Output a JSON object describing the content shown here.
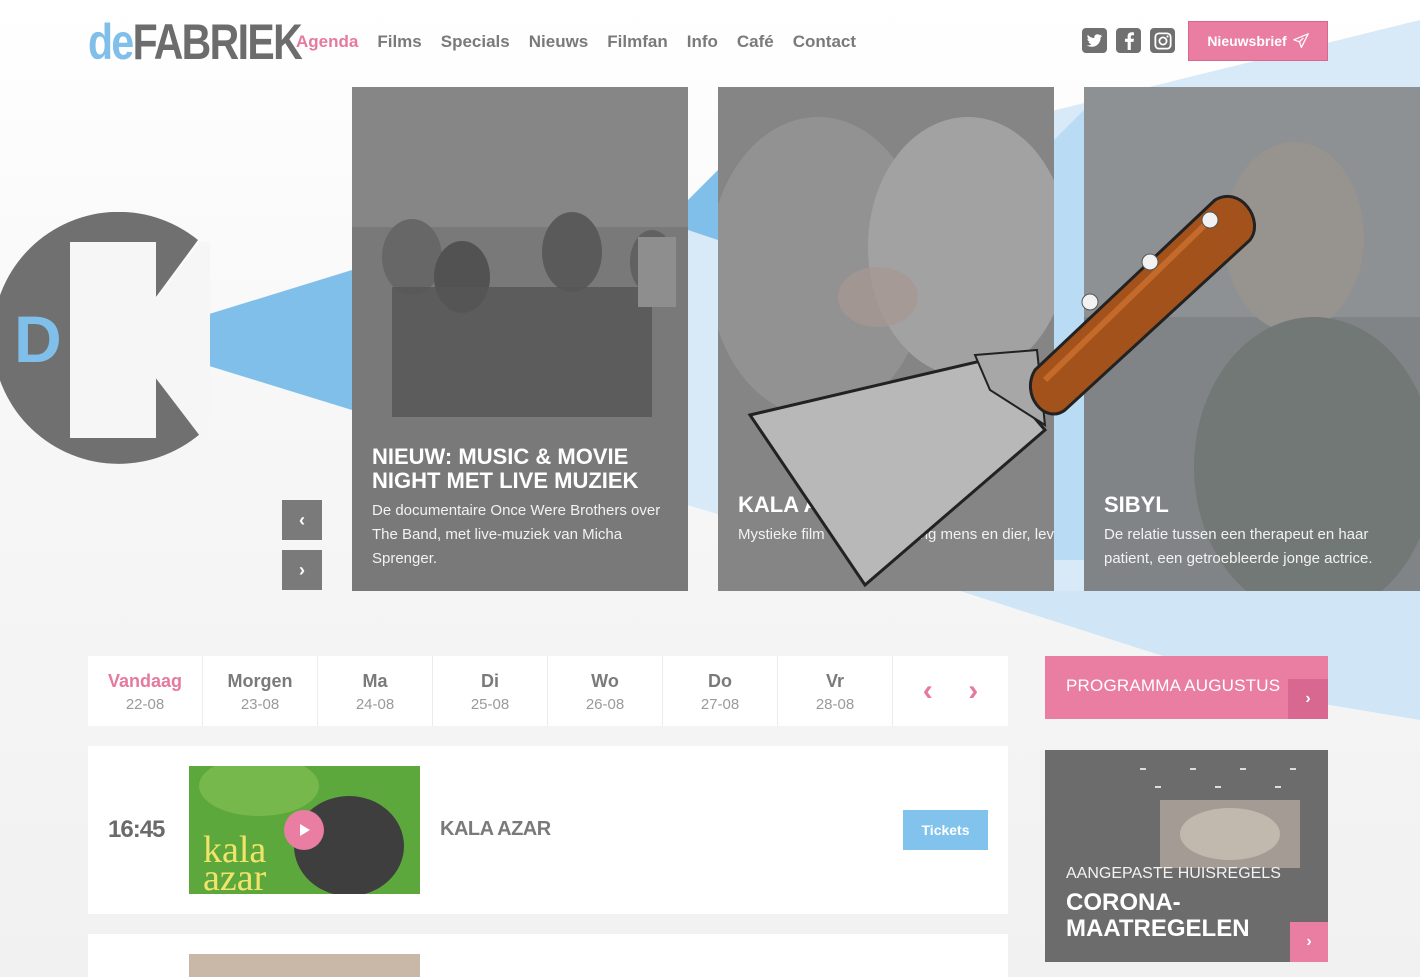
{
  "logo": {
    "de": "de",
    "fabriek": "FABRIEK"
  },
  "nav": [
    {
      "label": "Agenda",
      "active": true
    },
    {
      "label": "Films"
    },
    {
      "label": "Specials"
    },
    {
      "label": "Nieuws"
    },
    {
      "label": "Filmfan"
    },
    {
      "label": "Info"
    },
    {
      "label": "Café"
    },
    {
      "label": "Contact"
    }
  ],
  "social": {
    "twitter": "twitter-icon",
    "facebook": "facebook-icon",
    "instagram": "instagram-icon"
  },
  "newsletter": {
    "label": "Nieuwsbrief",
    "icon": "paper-plane-icon"
  },
  "bigmark": {
    "letter": "D"
  },
  "slider": {
    "prev": "‹",
    "next": "›",
    "slides": [
      {
        "title": "NIEUW: MUSIC & MOVIE NIGHT MET LIVE MUZIEK",
        "desc": "De documentaire Once Were Brothers over The Band, met live-muziek van Micha Sprenger."
      },
      {
        "title": "KALA A",
        "desc": "Mystieke film                    ding mens en dier, leven en do"
      },
      {
        "title": "SIBYL",
        "desc": "De relatie tussen een therapeut en haar patient, een getroebleerde jonge actrice."
      }
    ]
  },
  "days": [
    {
      "name": "Vandaag",
      "date": "22-08",
      "active": true
    },
    {
      "name": "Morgen",
      "date": "23-08"
    },
    {
      "name": "Ma",
      "date": "24-08"
    },
    {
      "name": "Di",
      "date": "25-08"
    },
    {
      "name": "Wo",
      "date": "26-08"
    },
    {
      "name": "Do",
      "date": "27-08"
    },
    {
      "name": "Vr",
      "date": "28-08"
    }
  ],
  "day_nav": {
    "prev": "‹",
    "next": "›"
  },
  "programma": {
    "label": "PROGRAMMA AUGUSTUS",
    "arrow": "›"
  },
  "listing": {
    "time": "16:45",
    "title": "KALA AZAR",
    "poster_text": "kala azar",
    "tickets": "Tickets"
  },
  "corona": {
    "small": "AANGEPASTE HUISREGELS",
    "big": "CORONA-MAATREGELEN",
    "arrow": "›"
  },
  "colors": {
    "accent_pink": "#e97ea2",
    "accent_blue": "#82c3ee",
    "text_gray": "#7a7a7a"
  }
}
